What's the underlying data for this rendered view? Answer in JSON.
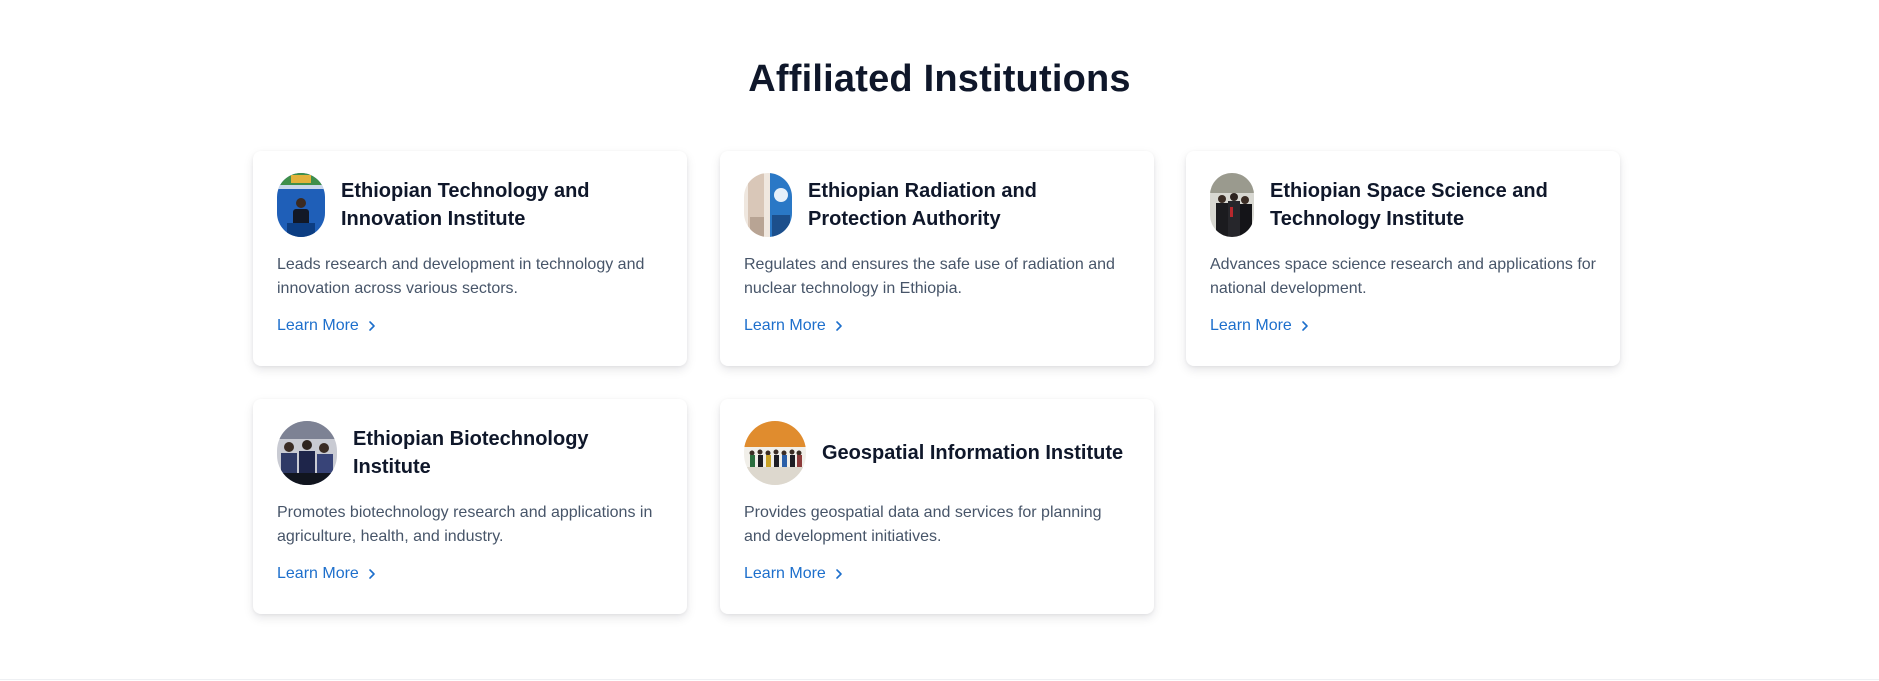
{
  "section": {
    "title": "Affiliated Institutions"
  },
  "cards": [
    {
      "title": "Ethiopian Technology and Innovation Institute",
      "description": "Leads research and development in technology and innovation across various sectors.",
      "link": "Learn More",
      "avatar_icon": "photo-speaker-podium"
    },
    {
      "title": "Ethiopian Radiation and Protection Authority",
      "description": "Regulates and ensures the safe use of radiation and nuclear technology in Ethiopia.",
      "link": "Learn More",
      "avatar_icon": "photo-emblem-banner"
    },
    {
      "title": "Ethiopian Space Science and Technology Institute",
      "description": "Advances space science research and applications for national development.",
      "link": "Learn More",
      "avatar_icon": "photo-group-formal"
    },
    {
      "title": "Ethiopian Biotechnology Institute",
      "description": "Promotes biotechnology research and applications in agriculture, health, and industry.",
      "link": "Learn More",
      "avatar_icon": "photo-group-audience"
    },
    {
      "title": "Geospatial Information Institute",
      "description": "Provides geospatial data and services for planning and development initiatives.",
      "link": "Learn More",
      "avatar_icon": "photo-group-lineup"
    }
  ],
  "colors": {
    "title": "#0f172a",
    "text": "#475569",
    "link": "#1d6fcc",
    "background": "#ffffff"
  }
}
